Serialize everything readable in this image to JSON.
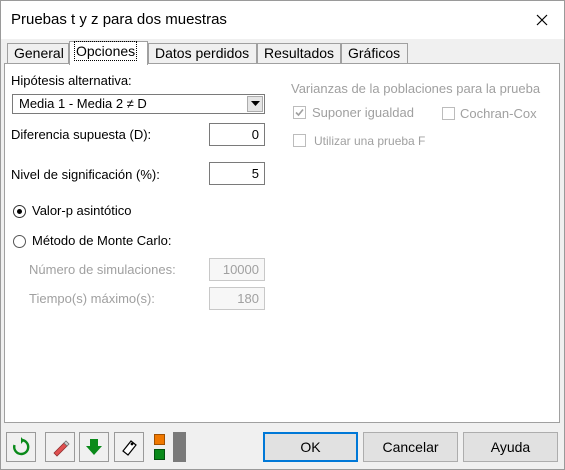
{
  "window": {
    "title": "Pruebas t y z para dos muestras"
  },
  "tabs": [
    {
      "label": "General"
    },
    {
      "label": "Opciones"
    },
    {
      "label": "Datos perdidos"
    },
    {
      "label": "Resultados"
    },
    {
      "label": "Gráficos"
    }
  ],
  "options": {
    "alt_hypothesis_label": "Hipótesis alternativa:",
    "alt_hypothesis_value": "Media 1 - Media 2 ≠ D",
    "diff_label": "Diferencia supuesta (D):",
    "diff_value": "0",
    "sig_label": "Nivel de significación (%):",
    "sig_value": "5",
    "pvalue_asym_label": "Valor-p asintótico",
    "monte_carlo_label": "Método de Monte Carlo:",
    "num_sim_label": "Número de simulaciones:",
    "num_sim_value": "10000",
    "max_time_label": "Tiempo(s) máximo(s):",
    "max_time_value": "180",
    "variances_title": "Varianzas de la poblaciones para la prueba",
    "assume_equal_label": "Suponer igualdad",
    "cochran_cox_label": "Cochran-Cox",
    "ftest_label": "Utilizar una prueba F"
  },
  "buttons": {
    "ok": "OK",
    "cancel": "Cancelar",
    "help": "Ayuda"
  },
  "colors": {
    "accent": "#0078d7",
    "green": "#0a8a1a",
    "orange": "#f07800"
  }
}
